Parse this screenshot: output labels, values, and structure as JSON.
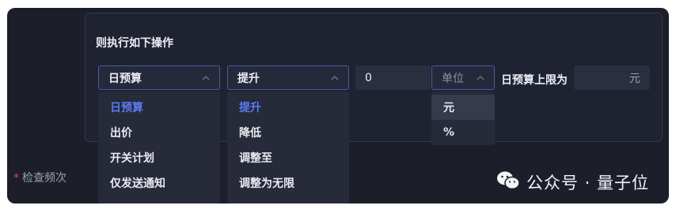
{
  "rule": {
    "title": "则执行如下操作"
  },
  "metric_select": {
    "value": "日预算",
    "options": [
      "日预算",
      "出价",
      "开关计划",
      "仅发送通知"
    ]
  },
  "action_select": {
    "value": "提升",
    "options": [
      "提升",
      "降低",
      "调整至",
      "调整为无限"
    ]
  },
  "amount_input": {
    "value": "0"
  },
  "unit_select": {
    "placeholder": "单位",
    "options": [
      "元",
      "%"
    ]
  },
  "limit": {
    "label": "日预算上限为",
    "unit": "元"
  },
  "check_frequency": {
    "required_mark": "*",
    "label": "检查频次"
  },
  "watermark": {
    "text": "公众号 · 量子位"
  },
  "colors": {
    "background": "#1c1f2a",
    "accent": "#5b7cf5",
    "required": "#e04848"
  }
}
